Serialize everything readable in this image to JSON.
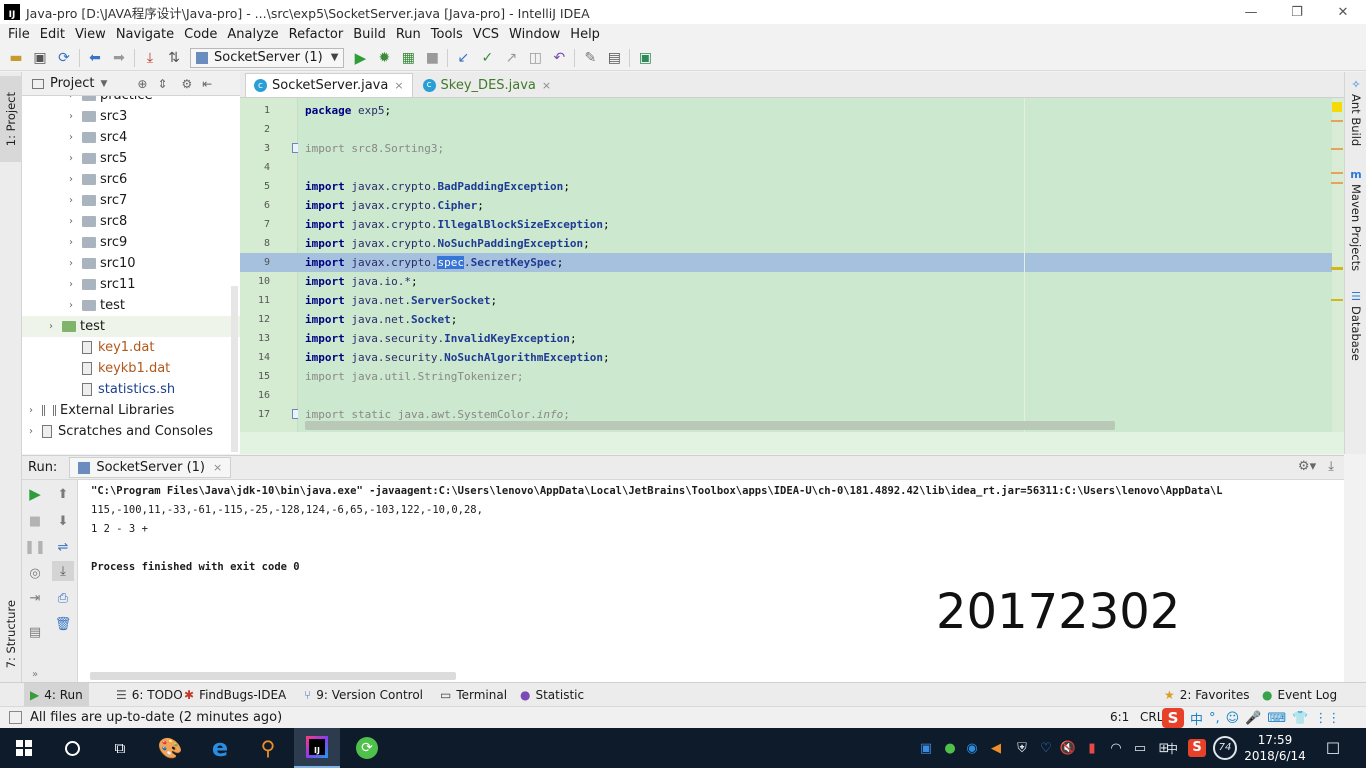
{
  "window": {
    "title": "Java-pro [D:\\JAVA程序设计\\Java-pro] - ...\\src\\exp5\\SocketServer.java [Java-pro] - IntelliJ IDEA",
    "controls": {
      "minimize": "—",
      "restore": "❐",
      "close": "✕"
    }
  },
  "menu": [
    {
      "label": "File"
    },
    {
      "label": "Edit"
    },
    {
      "label": "View"
    },
    {
      "label": "Navigate"
    },
    {
      "label": "Code"
    },
    {
      "label": "Analyze"
    },
    {
      "label": "Refactor"
    },
    {
      "label": "Build"
    },
    {
      "label": "Run"
    },
    {
      "label": "Tools"
    },
    {
      "label": "VCS"
    },
    {
      "label": "Window"
    },
    {
      "label": "Help"
    }
  ],
  "toolbar": {
    "run_config": "SocketServer (1)",
    "icons": [
      "open-icon",
      "save-icon",
      "sync-icon",
      "back-icon",
      "forward-icon",
      "make-icon",
      "build-icon",
      "run-icon",
      "debug-icon",
      "coverage-icon",
      "stop-icon",
      "vcs-update-icon",
      "vcs-commit-icon",
      "vcs-compare-icon",
      "vcs-history-icon",
      "revert-icon",
      "settings-icon",
      "project-structure-icon",
      "sdk-icon"
    ]
  },
  "left_strip": {
    "project_tab": "1: Project",
    "structure_tab": "7: Structure"
  },
  "right_strip": {
    "ant": "Ant Build",
    "maven": "Maven Projects",
    "database": "Database",
    "maven_glyph": "m"
  },
  "project": {
    "header": "Project",
    "items": [
      {
        "label": "practice",
        "kind": "folder",
        "indent": 2,
        "arrow": "›"
      },
      {
        "label": "src3",
        "kind": "folder",
        "indent": 2,
        "arrow": "›"
      },
      {
        "label": "src4",
        "kind": "folder",
        "indent": 2,
        "arrow": "›"
      },
      {
        "label": "src5",
        "kind": "folder",
        "indent": 2,
        "arrow": "›"
      },
      {
        "label": "src6",
        "kind": "folder",
        "indent": 2,
        "arrow": "›"
      },
      {
        "label": "src7",
        "kind": "folder",
        "indent": 2,
        "arrow": "›"
      },
      {
        "label": "src8",
        "kind": "folder",
        "indent": 2,
        "arrow": "›"
      },
      {
        "label": "src9",
        "kind": "folder",
        "indent": 2,
        "arrow": "›"
      },
      {
        "label": "src10",
        "kind": "folder",
        "indent": 2,
        "arrow": "›"
      },
      {
        "label": "src11",
        "kind": "folder",
        "indent": 2,
        "arrow": "›"
      },
      {
        "label": "test",
        "kind": "folder",
        "indent": 2,
        "arrow": "›"
      },
      {
        "label": "test",
        "kind": "folder-green",
        "indent": 1,
        "arrow": "›"
      },
      {
        "label": "key1.dat",
        "kind": "file-orange",
        "indent": 2,
        "arrow": ""
      },
      {
        "label": "keykb1.dat",
        "kind": "file-orange",
        "indent": 2,
        "arrow": ""
      },
      {
        "label": "statistics.sh",
        "kind": "file-blue",
        "indent": 2,
        "arrow": ""
      },
      {
        "label": "External Libraries",
        "kind": "lib",
        "indent": 0,
        "arrow": "›"
      },
      {
        "label": "Scratches and Consoles",
        "kind": "scratch",
        "indent": 0,
        "arrow": "›"
      }
    ]
  },
  "tabs": [
    {
      "label": "SocketServer.java",
      "active": true,
      "close": "×"
    },
    {
      "label": "Skey_DES.java",
      "active": false,
      "close": "×"
    }
  ],
  "editor": {
    "lines": [
      {
        "n": "1",
        "parts": [
          [
            "kw",
            "package"
          ],
          [
            "",
            " "
          ],
          [
            "pk",
            "exp5"
          ],
          [
            "",
            ";"
          ]
        ]
      },
      {
        "n": "2",
        "parts": []
      },
      {
        "n": "3",
        "parts": [
          [
            "dim",
            "import src8.Sorting3;"
          ]
        ],
        "fold": true
      },
      {
        "n": "4",
        "parts": []
      },
      {
        "n": "5",
        "parts": [
          [
            "kw",
            "import"
          ],
          [
            "",
            " "
          ],
          [
            "pk",
            "javax.crypto."
          ],
          [
            "cls",
            "BadPaddingException"
          ],
          [
            "",
            ";"
          ]
        ]
      },
      {
        "n": "6",
        "parts": [
          [
            "kw",
            "import"
          ],
          [
            "",
            " "
          ],
          [
            "pk",
            "javax.crypto."
          ],
          [
            "cls",
            "Cipher"
          ],
          [
            "",
            ";"
          ]
        ]
      },
      {
        "n": "7",
        "parts": [
          [
            "kw",
            "import"
          ],
          [
            "",
            " "
          ],
          [
            "pk",
            "javax.crypto."
          ],
          [
            "cls",
            "IllegalBlockSizeException"
          ],
          [
            "",
            ";"
          ]
        ]
      },
      {
        "n": "8",
        "parts": [
          [
            "kw",
            "import"
          ],
          [
            "",
            " "
          ],
          [
            "pk",
            "javax.crypto."
          ],
          [
            "cls",
            "NoSuchPaddingException"
          ],
          [
            "",
            ";"
          ]
        ]
      },
      {
        "n": "9",
        "parts": [
          [
            "kw",
            "import"
          ],
          [
            "",
            " "
          ],
          [
            "pk",
            "javax.crypto."
          ],
          [
            "selword",
            "spec"
          ],
          [
            "pk",
            "."
          ],
          [
            "cls",
            "SecretKeySpec"
          ],
          [
            "",
            ";"
          ]
        ],
        "highlight": true
      },
      {
        "n": "10",
        "parts": [
          [
            "kw",
            "import"
          ],
          [
            "",
            " "
          ],
          [
            "pk",
            "java.io.*"
          ],
          [
            "",
            ";"
          ]
        ]
      },
      {
        "n": "11",
        "parts": [
          [
            "kw",
            "import"
          ],
          [
            "",
            " "
          ],
          [
            "pk",
            "java.net."
          ],
          [
            "cls",
            "ServerSocket"
          ],
          [
            "",
            ";"
          ]
        ]
      },
      {
        "n": "12",
        "parts": [
          [
            "kw",
            "import"
          ],
          [
            "",
            " "
          ],
          [
            "pk",
            "java.net."
          ],
          [
            "cls",
            "Socket"
          ],
          [
            "",
            ";"
          ]
        ]
      },
      {
        "n": "13",
        "parts": [
          [
            "kw",
            "import"
          ],
          [
            "",
            " "
          ],
          [
            "pk",
            "java.security."
          ],
          [
            "cls",
            "InvalidKeyException"
          ],
          [
            "",
            ";"
          ]
        ]
      },
      {
        "n": "14",
        "parts": [
          [
            "kw",
            "import"
          ],
          [
            "",
            " "
          ],
          [
            "pk",
            "java.security."
          ],
          [
            "cls",
            "NoSuchAlgorithmException"
          ],
          [
            "",
            ";"
          ]
        ]
      },
      {
        "n": "15",
        "parts": [
          [
            "dim",
            "import java.util.StringTokenizer;"
          ]
        ]
      },
      {
        "n": "16",
        "parts": []
      },
      {
        "n": "17",
        "parts": [
          [
            "dim",
            "import static java.awt.SystemColor."
          ],
          [
            "dim it",
            "info"
          ],
          [
            "dim",
            ";"
          ]
        ],
        "fold": true
      }
    ]
  },
  "run": {
    "label": "Run:",
    "tab": "SocketServer (1)",
    "tab_close": "×",
    "console": [
      "\"C:\\Program Files\\Java\\jdk-10\\bin\\java.exe\" -javaagent:C:\\Users\\lenovo\\AppData\\Local\\JetBrains\\Toolbox\\apps\\IDEA-U\\ch-0\\181.4892.42\\lib\\idea_rt.jar=56311:C:\\Users\\lenovo\\AppData\\L",
      "115,-100,11,-33,-61,-115,-25,-128,124,-6,65,-103,122,-10,0,28,",
      "1 2 - 3 +",
      "",
      "Process finished with exit code 0"
    ],
    "watermark": "20172302"
  },
  "bottom_tabs": [
    {
      "label": "4: Run",
      "icon": "run-icon",
      "glyph": "▶",
      "color": "#3a9b3a",
      "active": true
    },
    {
      "label": "6: TODO",
      "icon": "todo-icon",
      "glyph": "☰",
      "color": "#555555",
      "active": false
    },
    {
      "label": "FindBugs-IDEA",
      "icon": "bug-icon",
      "glyph": "✱",
      "color": "#c0392b",
      "active": false
    },
    {
      "label": "9: Version Control",
      "icon": "vcs-icon",
      "glyph": "⑂",
      "color": "#4a78b5",
      "active": false
    },
    {
      "label": "Terminal",
      "icon": "terminal-icon",
      "glyph": "▭",
      "color": "#444444",
      "active": false
    },
    {
      "label": "Statistic",
      "icon": "statistic-icon",
      "glyph": "●",
      "color": "#7b4bb5",
      "active": false
    },
    {
      "label": "2: Favorites",
      "icon": "star-icon",
      "glyph": "★",
      "color": "#d8a021",
      "active": false
    },
    {
      "label": "Event Log",
      "icon": "event-log-icon",
      "glyph": "●",
      "color": "#3aa34a",
      "active": false
    }
  ],
  "status": {
    "message": "All files are up-to-date (2 minutes ago)",
    "position": "6:1",
    "line_sep": "CRL",
    "ime_glyphs": [
      "中",
      "°,",
      "☺",
      "🎤",
      "⌨",
      "👕",
      "⋮⋮"
    ]
  },
  "taskbar": {
    "time": "17:59",
    "date": "2018/6/14",
    "lang": "中",
    "battery_badge": "74",
    "apps": [
      "windows-start-icon",
      "search-icon",
      "task-view-icon",
      "paint-icon",
      "edge-icon",
      "search-app-icon",
      "intellij-icon",
      "green-app-icon"
    ]
  },
  "colors": {
    "editor_bg": "#cce8cf",
    "highlight_row": "#a6c1dd",
    "selection": "#3875d7",
    "taskbar": "#0e1b2a"
  }
}
